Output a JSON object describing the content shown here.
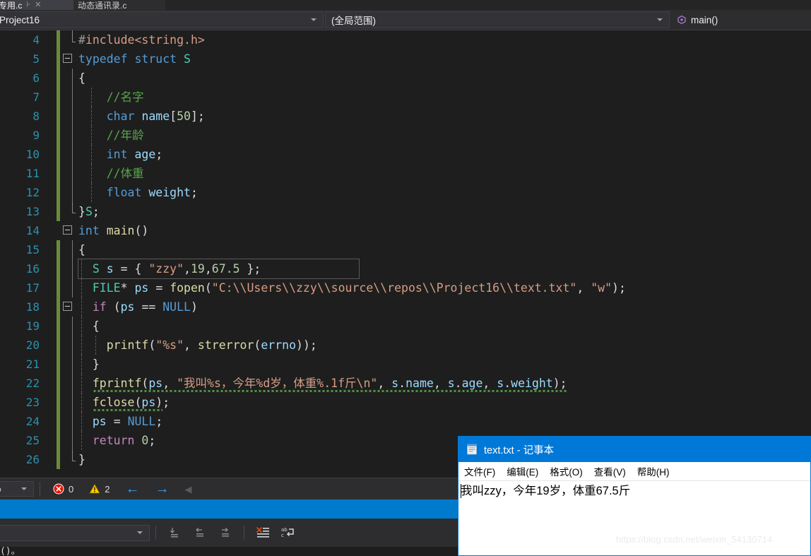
{
  "tabs": [
    {
      "label": "专用.c",
      "state": "active",
      "pin_icon": "pin-icon",
      "close_icon": "close-icon"
    },
    {
      "label": "动态通讯录.c",
      "state": "inactive"
    }
  ],
  "navbar": {
    "project": "Project16",
    "scope": "(全局范围)",
    "function": "main()",
    "function_icon": "method-icon",
    "dropdown_icon": "chevron-down-icon"
  },
  "editor": {
    "lines": [
      {
        "num": "4",
        "modified": true,
        "fold": "none"
      },
      {
        "num": "5",
        "modified": true,
        "fold": "collapse"
      },
      {
        "num": "6",
        "modified": true,
        "fold": "none"
      },
      {
        "num": "7",
        "modified": true,
        "fold": "none"
      },
      {
        "num": "8",
        "modified": true,
        "fold": "none"
      },
      {
        "num": "9",
        "modified": true,
        "fold": "none"
      },
      {
        "num": "10",
        "modified": true,
        "fold": "none"
      },
      {
        "num": "11",
        "modified": true,
        "fold": "none"
      },
      {
        "num": "12",
        "modified": true,
        "fold": "none"
      },
      {
        "num": "13",
        "modified": true,
        "fold": "none"
      },
      {
        "num": "14",
        "modified": false,
        "fold": "collapse"
      },
      {
        "num": "15",
        "modified": true,
        "fold": "none"
      },
      {
        "num": "16",
        "modified": true,
        "fold": "none"
      },
      {
        "num": "17",
        "modified": true,
        "fold": "none"
      },
      {
        "num": "18",
        "modified": true,
        "fold": "collapse"
      },
      {
        "num": "19",
        "modified": true,
        "fold": "none"
      },
      {
        "num": "20",
        "modified": true,
        "fold": "none"
      },
      {
        "num": "21",
        "modified": true,
        "fold": "none"
      },
      {
        "num": "22",
        "modified": true,
        "fold": "none"
      },
      {
        "num": "23",
        "modified": true,
        "fold": "none"
      },
      {
        "num": "24",
        "modified": true,
        "fold": "none"
      },
      {
        "num": "25",
        "modified": true,
        "fold": "none"
      },
      {
        "num": "26",
        "modified": true,
        "fold": "none"
      }
    ],
    "code": {
      "l4": "#include<string.h>",
      "l5": "typedef struct S",
      "l6": "{",
      "l7": "//名字",
      "l8": "char name[50];",
      "l9": "//年龄",
      "l10": "int age;",
      "l11": "//体重",
      "l12": "float weight;",
      "l13": "}S;",
      "l14": "int main()",
      "l15": "{",
      "l16": "S s = { \"zzy\",19,67.5 };",
      "l17": "FILE* ps = fopen(\"C:\\\\Users\\\\zzy\\\\source\\\\repos\\\\Project16\\\\text.txt\", \"w\");",
      "l18": "if (ps == NULL)",
      "l19": "{",
      "l20": "printf(\"%s\", strerror(errno));",
      "l21": "}",
      "l22": "fprintf(ps, \"我叫%s，今年%d岁，体重%.1f斤\\n\", s.name, s.age, s.weight);",
      "l23": "fclose(ps);",
      "l24": "ps = NULL;",
      "l25": "return 0;",
      "l26": "}"
    }
  },
  "statusbar": {
    "zoom": "%",
    "error_count": "0",
    "warning_count": "2",
    "error_icon": "error-icon",
    "warning_icon": "warning-icon",
    "back_arrow": "arrow-left-icon",
    "forward_arrow": "arrow-right-icon",
    "collapse_arrow": "triangle-left-icon"
  },
  "bottom_toolbar": {
    "combo_value": "",
    "buttons": [
      {
        "icon": "step-into-icon",
        "enabled": false
      },
      {
        "icon": "step-out-icon",
        "enabled": false
      },
      {
        "icon": "step-over-icon",
        "enabled": false
      },
      {
        "icon": "clear-all-icon",
        "enabled": true
      },
      {
        "icon": "word-wrap-icon",
        "enabled": true
      }
    ]
  },
  "output_sliver": "()。",
  "notepad": {
    "title": "text.txt - 记事本",
    "icon": "notepad-icon",
    "menu": [
      "文件(F)",
      "编辑(E)",
      "格式(O)",
      "查看(V)",
      "帮助(H)"
    ],
    "content": "我叫zzy，今年19岁，体重67.5斤"
  },
  "watermark": "https://blog.csdn.net/weixin_54130714",
  "colors": {
    "accent_blue": "#007acc",
    "notepad_title": "#0078d7",
    "editor_bg": "#1e1e1e",
    "chrome_bg": "#2d2d30",
    "changebar_green": "#6a8a3a",
    "squiggle_green": "#57a64a"
  }
}
